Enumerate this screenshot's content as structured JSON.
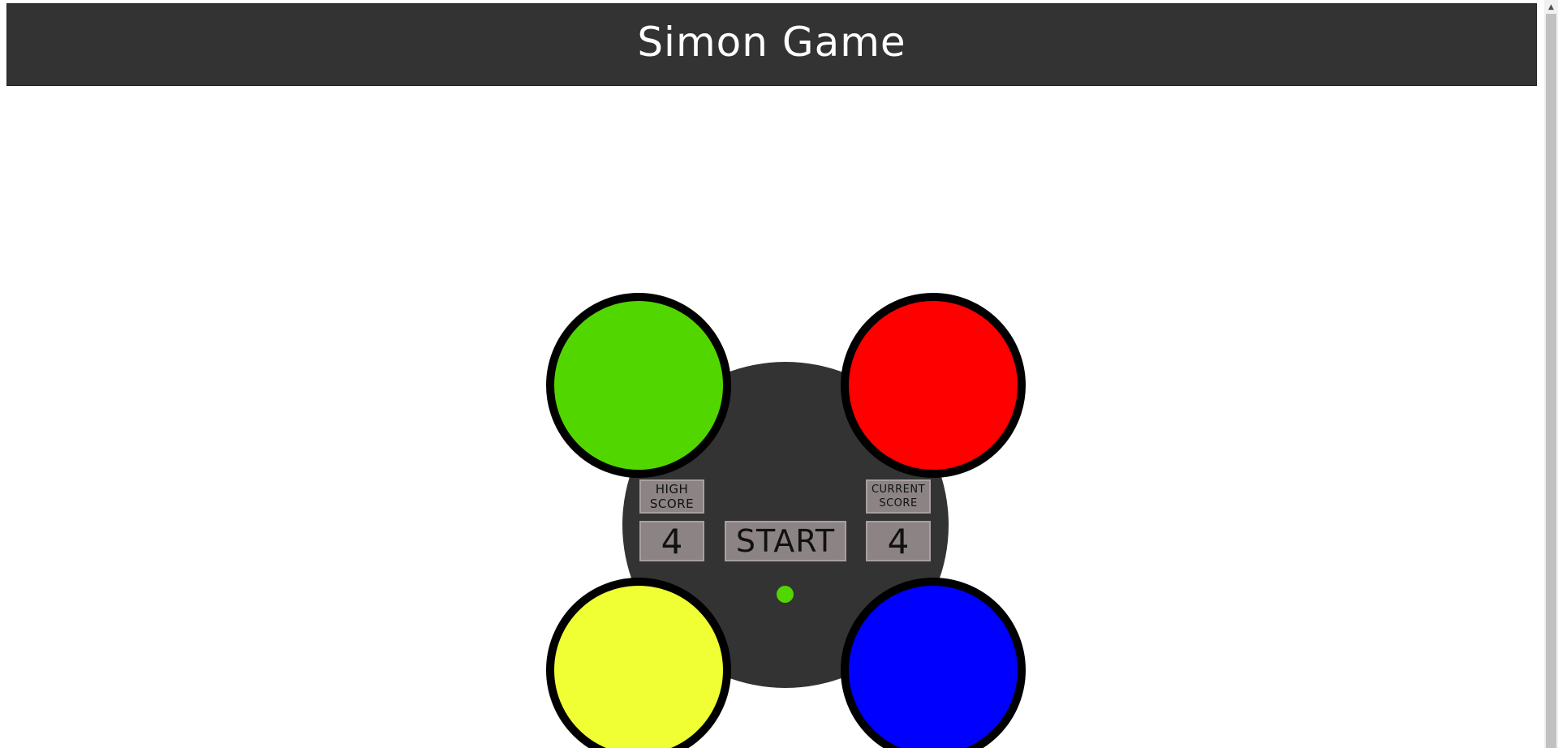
{
  "header": {
    "title": "Simon Game"
  },
  "pads": {
    "green": "#52d600",
    "red": "#ff0000",
    "yellow": "#f0ff33",
    "blue": "#0000ff"
  },
  "scores": {
    "high_label": "HIGH SCORE",
    "high_value": "4",
    "current_label": "CURRENT SCORE",
    "current_value": "4"
  },
  "controls": {
    "start_label": "START"
  },
  "status": {
    "led_color": "#52d600"
  },
  "scrollbar": {
    "up_icon": "▲"
  }
}
